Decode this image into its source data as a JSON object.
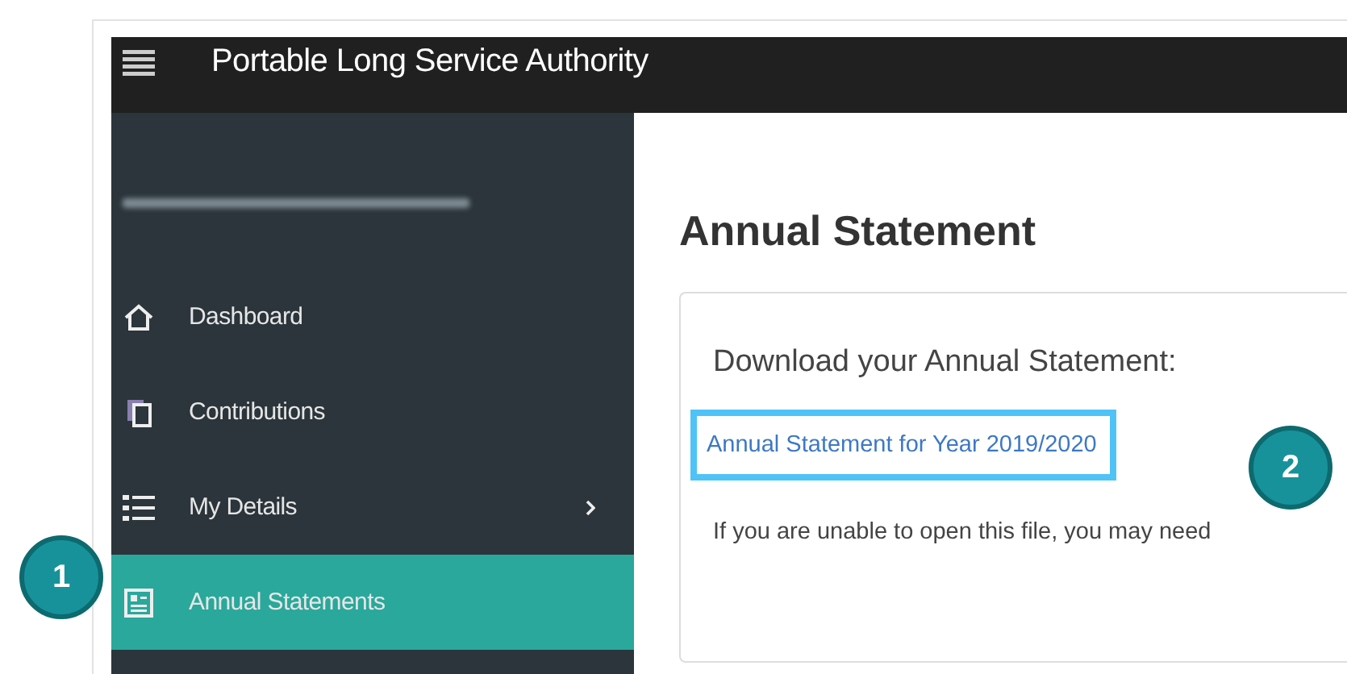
{
  "header": {
    "title": "Portable Long Service Authority"
  },
  "sidebar": {
    "items": [
      {
        "label": "Dashboard",
        "selected": false,
        "has_children": false
      },
      {
        "label": "Contributions",
        "selected": false,
        "has_children": false
      },
      {
        "label": "My Details",
        "selected": false,
        "has_children": true
      },
      {
        "label": "Annual Statements",
        "selected": true,
        "has_children": false
      }
    ]
  },
  "main": {
    "title": "Annual Statement",
    "card": {
      "heading": "Download your Annual Statement:",
      "link": {
        "text": "Annual Statement for Year 2019/2020",
        "highlighted": true
      },
      "note": "If you are unable to open this file, you may need"
    }
  },
  "callouts": [
    {
      "label": "1"
    },
    {
      "label": "2"
    }
  ]
}
